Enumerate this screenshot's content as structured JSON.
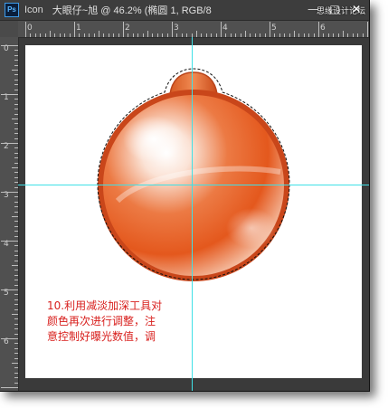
{
  "window": {
    "app_logo": "Ps",
    "app_name": "Icon",
    "document_title": "大眼仔~旭 @ 46.2% (椭圆 1, RGB/8",
    "watermark": "思缘设计论坛",
    "controls": {
      "minimize": "—",
      "maximize": "□",
      "close": "✕"
    }
  },
  "ruler": {
    "horizontal_labels": [
      "0",
      "1",
      "2",
      "3",
      "4",
      "5",
      "6"
    ],
    "vertical_labels": [
      "0",
      "1",
      "2",
      "3",
      "4",
      "5",
      "6"
    ]
  },
  "canvas": {
    "zoom_level": "46.2%",
    "guide_color": "#3fe0e6",
    "ornament_colors": {
      "primary": "#e2551c",
      "rim": "#c9461a",
      "highlight": "#ffffff"
    }
  },
  "annotation": {
    "lines": [
      "10.利用减淡加深工具对",
      "颜色再次进行调整，注",
      "意控制好曝光数值，调"
    ],
    "color": "#d8201e"
  }
}
